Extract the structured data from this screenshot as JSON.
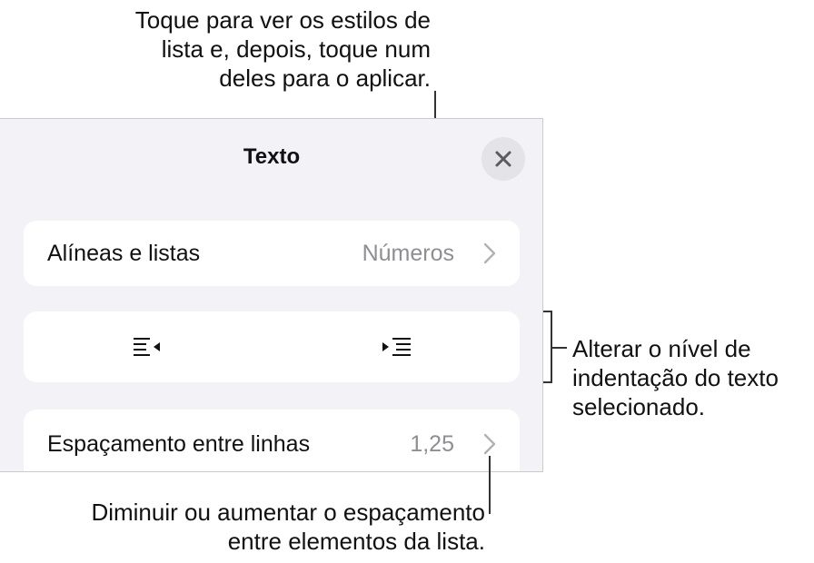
{
  "panel": {
    "title": "Texto",
    "close_icon": "close-icon"
  },
  "rows": {
    "bullets": {
      "label": "Alíneas e listas",
      "value": "Números"
    },
    "spacing": {
      "label": "Espaçamento entre linhas",
      "value": "1,25"
    }
  },
  "indent": {
    "decrease_icon": "decrease-indent-icon",
    "increase_icon": "increase-indent-icon"
  },
  "callouts": {
    "top": [
      "Toque para ver os estilos de",
      "lista e, depois, toque num",
      "deles para o aplicar."
    ],
    "right": [
      "Alterar o nível de",
      "indentação do texto",
      "selecionado."
    ],
    "bottom": [
      "Diminuir ou aumentar o espaçamento",
      "entre elementos da lista."
    ]
  },
  "colors": {
    "panel_bg": "#f2f2f7",
    "card_bg": "#ffffff",
    "secondary_text": "#8e8e93"
  }
}
